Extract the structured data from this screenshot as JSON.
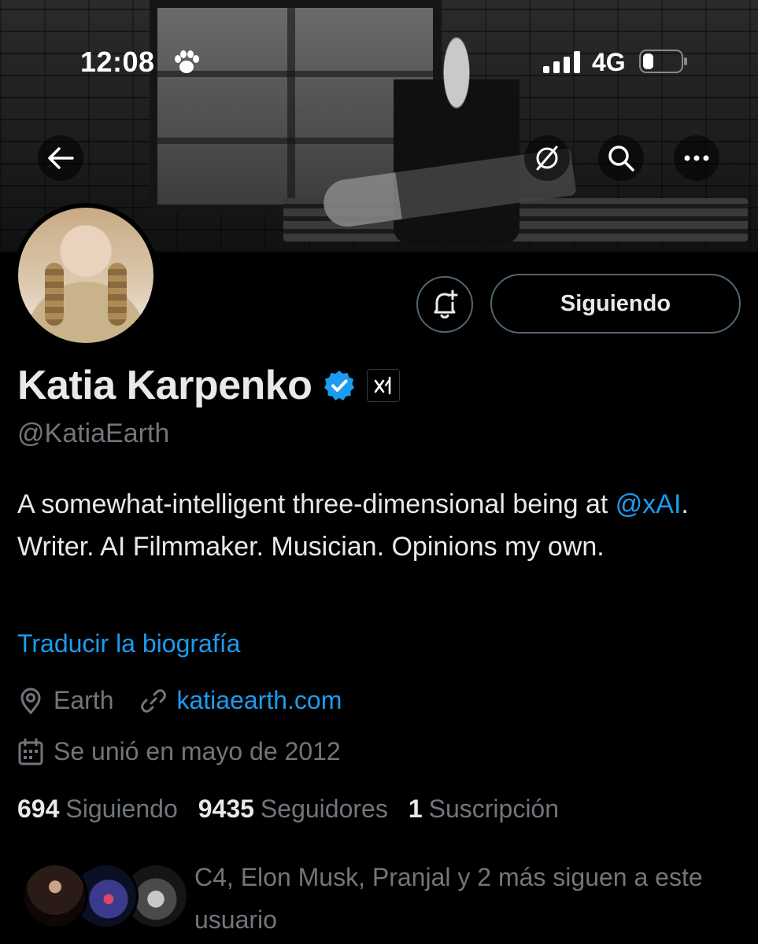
{
  "status_bar": {
    "time": "12:08",
    "network": "4G",
    "icons": [
      "paw-icon",
      "signal-icon",
      "battery-icon"
    ]
  },
  "header_actions": {
    "back_icon": "arrow-left-icon",
    "grok_icon": "grok-icon",
    "search_icon": "search-icon",
    "more_icon": "more-horizontal-icon"
  },
  "profile": {
    "display_name": "Katia Karpenko",
    "handle": "@KatiaEarth",
    "verified": true,
    "affiliate_badge": "xAI",
    "bio_part1": "A somewhat-intelligent three-dimensional being at ",
    "bio_mention": "@xAI",
    "bio_part2": ". Writer. AI Filmmaker. Musician. Opinions my own.",
    "translate_bio": "Traducir la biografía",
    "location": "Earth",
    "website": "katiaearth.com",
    "joined": "Se unió en mayo de 2012"
  },
  "buttons": {
    "notifications_icon": "bell-plus-icon",
    "following_label": "Siguiendo"
  },
  "stats": {
    "following_count": "694",
    "following_label": "Siguiendo",
    "followers_count": "9435",
    "followers_label": "Seguidores",
    "subscriptions_count": "1",
    "subscriptions_label": "Suscripción"
  },
  "followed_by": {
    "text": "C4, Elon Musk, Pranjal y 2 más siguen a este usuario"
  },
  "colors": {
    "background": "#000000",
    "accent": "#1d9bf0",
    "secondary_text": "#71767b",
    "primary_text": "#e7e9ea",
    "border": "#536471"
  }
}
